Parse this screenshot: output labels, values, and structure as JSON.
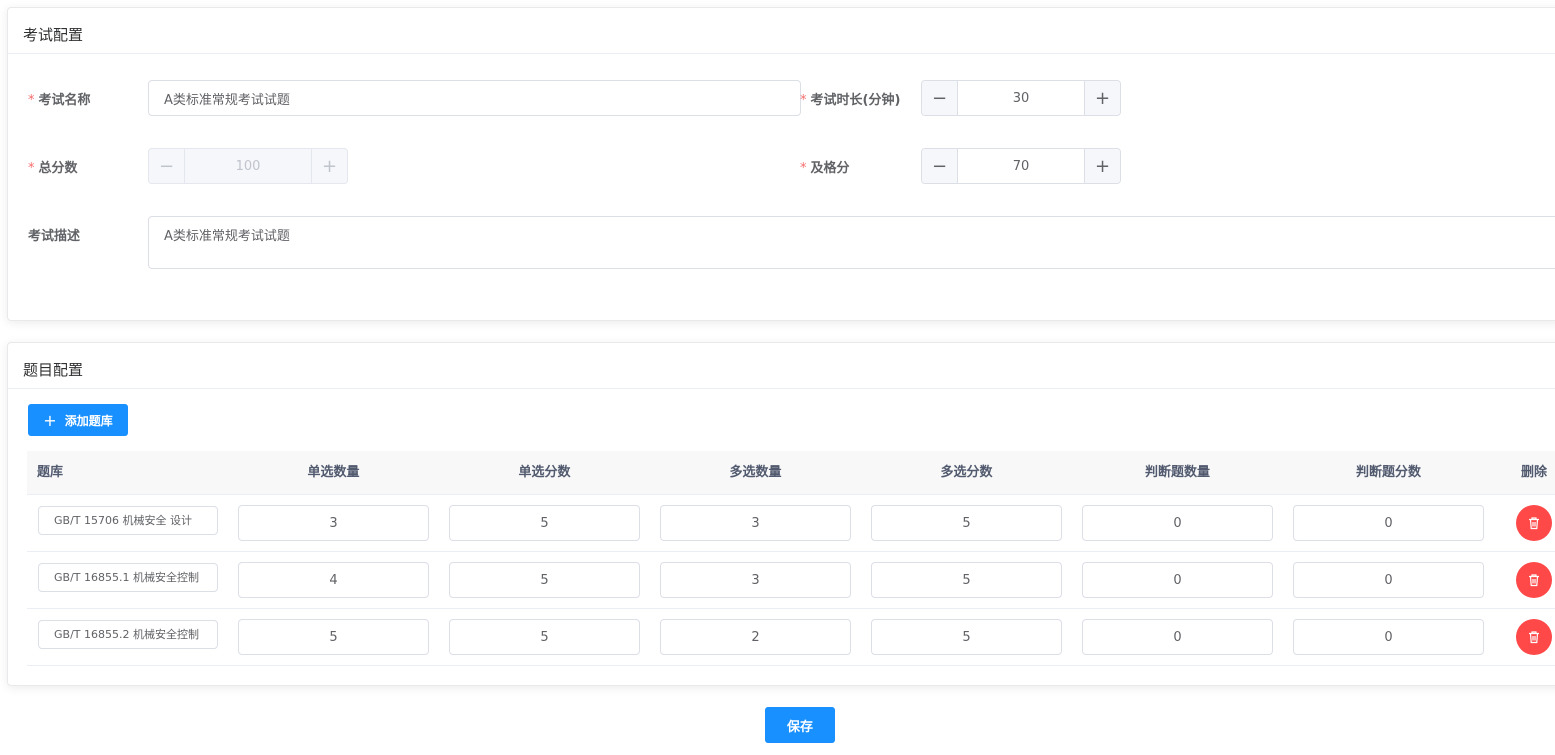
{
  "exam_config": {
    "title": "考试配置",
    "name_label": "考试名称",
    "name_value": "A类标准常规考试试题",
    "duration_label": "考试时长(分钟)",
    "duration_value": "30",
    "total_label": "总分数",
    "total_value": "100",
    "pass_label": "及格分",
    "pass_value": "70",
    "desc_label": "考试描述",
    "desc_value": "A类标准常规考试试题",
    "required_mark": "*"
  },
  "question_config": {
    "title": "题目配置",
    "add_button": "添加题库",
    "columns": [
      "题库",
      "单选数量",
      "单选分数",
      "多选数量",
      "多选分数",
      "判断题数量",
      "判断题分数",
      "删除"
    ],
    "rows": [
      {
        "bank": "GB/T 15706 机械安全 设计",
        "single_count": "3",
        "single_score": "5",
        "multi_count": "3",
        "multi_score": "5",
        "judge_count": "0",
        "judge_score": "0"
      },
      {
        "bank": "GB/T 16855.1 机械安全控制",
        "single_count": "4",
        "single_score": "5",
        "multi_count": "3",
        "multi_score": "5",
        "judge_count": "0",
        "judge_score": "0"
      },
      {
        "bank": "GB/T 16855.2 机械安全控制",
        "single_count": "5",
        "single_score": "5",
        "multi_count": "2",
        "multi_score": "5",
        "judge_count": "0",
        "judge_score": "0"
      }
    ]
  },
  "save_button": "保存",
  "icons": {
    "minus": "minus-icon",
    "plus": "plus-icon",
    "delete": "trash-icon"
  },
  "colors": {
    "primary": "#1890ff",
    "danger": "#ff4949",
    "required": "#f56c6c"
  }
}
